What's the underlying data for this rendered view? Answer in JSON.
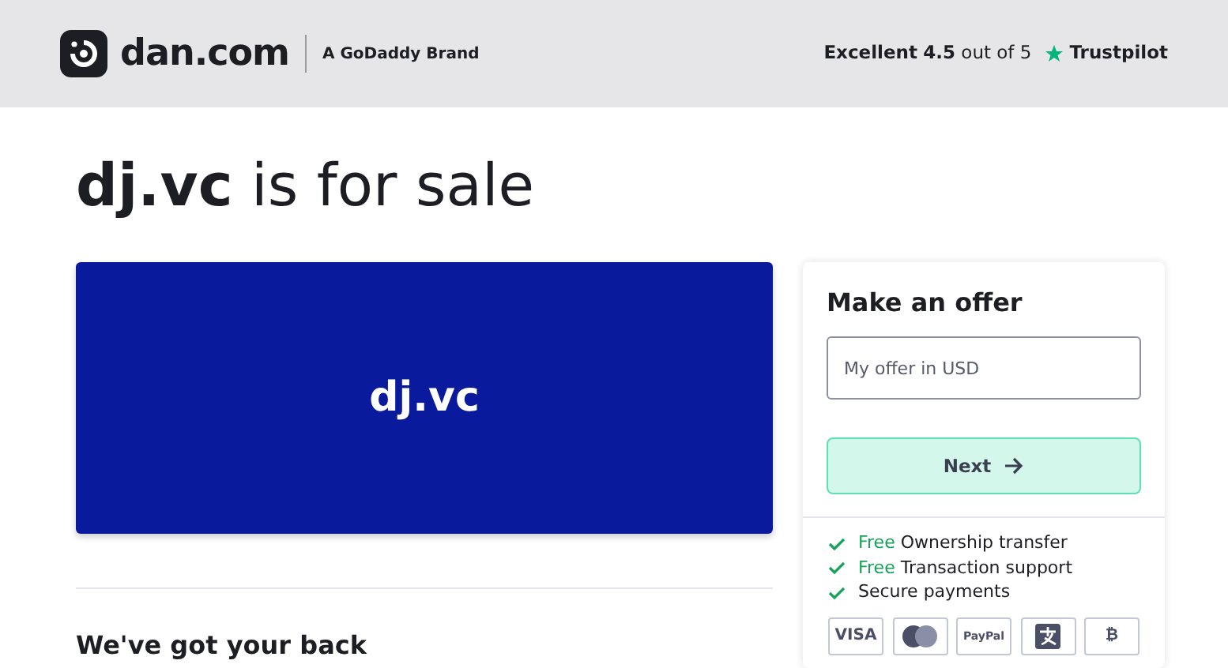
{
  "header": {
    "brand": "dan.com",
    "tagline": "A GoDaddy Brand",
    "rating": {
      "label": "Excellent",
      "score": "4.5",
      "suffix": "out of 5",
      "provider": "Trustpilot"
    }
  },
  "title": {
    "domain": "dj.vc",
    "rest": "is for sale"
  },
  "banner": {
    "text": "dj.vc"
  },
  "offer": {
    "heading": "Make an offer",
    "placeholder": "My offer in USD",
    "button": "Next",
    "features": [
      {
        "free": "Free",
        "text": "Ownership transfer"
      },
      {
        "free": "Free",
        "text": "Transaction support"
      },
      {
        "text": "Secure payments"
      }
    ],
    "payments": [
      {
        "kind": "text",
        "label": "VISA"
      },
      {
        "kind": "mastercard"
      },
      {
        "kind": "text",
        "label": "PayPal"
      },
      {
        "kind": "alipay"
      },
      {
        "kind": "text",
        "label": "₿"
      }
    ]
  },
  "section": {
    "heading": "We've got your back"
  }
}
